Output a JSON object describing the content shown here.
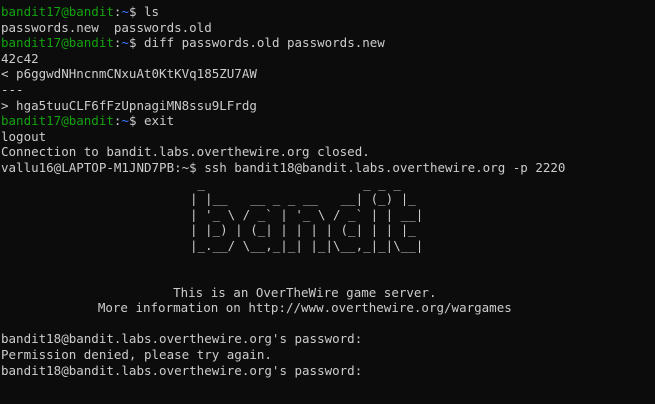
{
  "colors": {
    "background": "#0c0c0c",
    "text": "#cccccc",
    "prompt_user": "#13a10e",
    "prompt_path": "#3b78ff"
  },
  "session1": {
    "prompt_user": "bandit17@bandit",
    "prompt_colon": ":",
    "prompt_path": "~",
    "prompt_dollar": "$ ",
    "cmd_ls": "ls",
    "ls_output": "passwords.new  passwords.old",
    "cmd_diff": "diff passwords.old passwords.new",
    "diff_header": "42c42",
    "diff_old": "< p6ggwdNHncnmCNxuAt0KtKVq185ZU7AW",
    "diff_sep": "---",
    "diff_new": "> hga5tuuCLF6fFzUpnagiMN8ssu9LFrdg",
    "cmd_exit": "exit",
    "logout": "logout",
    "closed_msg": "Connection to bandit.labs.overthewire.org closed."
  },
  "local": {
    "prompt": "vallu16@LAPTOP-M1JND7PB:~$ ",
    "cmd_ssh": "ssh bandit18@bandit.labs.overthewire.org -p 2220"
  },
  "banner": {
    "ascii": " _                     _ _ _   \n| |__   __ _ _ __   __| (_) |_ \n| '_ \\ / _` | '_ \\ / _` | | __|\n| |_) | (_| | | | | (_| | | |_ \n|_.__/ \\__,_|_| |_|\\__,_|_|\\__|",
    "line1": "                       This is an OverTheWire game server.",
    "line2": "             More information on http://www.overthewire.org/wargames"
  },
  "auth": {
    "password_prompt_1": "bandit18@bandit.labs.overthewire.org's password:",
    "denied": "Permission denied, please try again.",
    "password_prompt_2": "bandit18@bandit.labs.overthewire.org's password:"
  }
}
